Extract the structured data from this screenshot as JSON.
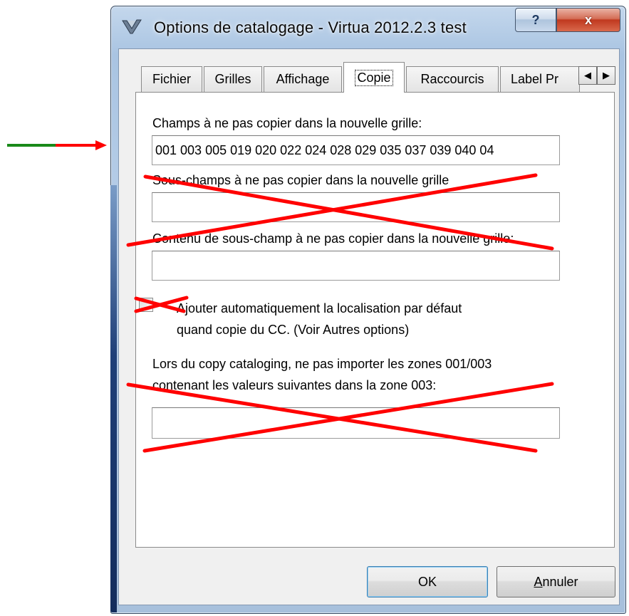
{
  "window": {
    "title": "Options de catalogage - Virtua 2012.2.3 test",
    "help_label": "?",
    "close_label": "x"
  },
  "tabs": [
    {
      "label": "Fichier"
    },
    {
      "label": "Grilles"
    },
    {
      "label": "Affichage"
    },
    {
      "label": "Copie"
    },
    {
      "label": "Raccourcis"
    },
    {
      "label": "Label Pr"
    }
  ],
  "active_tab": "Copie",
  "tab_scroll": {
    "left": "◀",
    "right": "▶"
  },
  "copie": {
    "fields_label": "Champs à ne pas copier dans la nouvelle grille:",
    "fields_value": "001 003 005 019 020 022 024 028 029 035 037 039 040 04",
    "subfields_label": "Sous-champs à ne pas copier dans la nouvelle grille",
    "subfields_value": "",
    "subfield_content_label": "Contenu de sous-champ à ne pas copier dans la nouvelle grille:",
    "subfield_content_value": "",
    "auto_location_line1": "Ajouter automatiquement la localisation par défaut",
    "auto_location_line2": "quand copie du CC. (Voir Autres options)",
    "auto_location_checked": false,
    "copycat_line1": "Lors du copy cataloging, ne pas importer les zones 001/003",
    "copycat_line2": "contenant les valeurs suivantes dans la zone 003:",
    "copycat_value": ""
  },
  "buttons": {
    "ok": "OK",
    "cancel": "Annuler"
  },
  "annotation_colors": {
    "cross": "#ff0000",
    "arrow_tail": "#1a8a1a",
    "arrow_head": "#ff0000"
  }
}
